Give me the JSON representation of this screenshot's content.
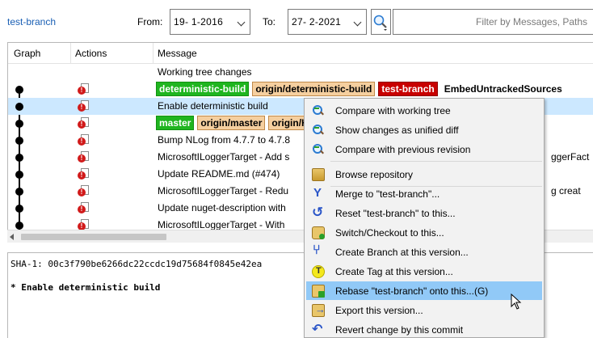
{
  "toolbar": {
    "branch": "test-branch",
    "from_label": "From:",
    "from_date": "19-  1-2016",
    "to_label": "To:",
    "to_date": "27-  2-2021",
    "filter_placeholder": "Filter by Messages, Paths"
  },
  "grid": {
    "columns": [
      "Graph",
      "Actions",
      "Message"
    ],
    "rows": [
      {
        "message": "Working tree changes"
      },
      {
        "refs": [
          {
            "label": "deterministic-build",
            "style": "green"
          },
          {
            "label": "origin/deterministic-build",
            "style": "orange"
          },
          {
            "label": "test-branch",
            "style": "red"
          },
          {
            "label": "EmbedUntrackedSources",
            "style": "plain"
          }
        ]
      },
      {
        "message": "Enable deterministic build",
        "selected": true
      },
      {
        "refs": [
          {
            "label": "master",
            "style": "green"
          },
          {
            "label": "origin/master",
            "style": "orange"
          },
          {
            "label": "origin/H",
            "style": "orange"
          }
        ]
      },
      {
        "message": "Bump NLog from 4.7.7 to 4.7.8"
      },
      {
        "message": "MicrosoftILoggerTarget - Add s",
        "tail": "ggerFact"
      },
      {
        "message": "Update README.md (#474)"
      },
      {
        "message": "MicrosoftILoggerTarget - Redu",
        "tail": "g creat"
      },
      {
        "message": "Update nuget-description with"
      },
      {
        "message": "MicrosoftILoggerTarget - With"
      }
    ]
  },
  "commit_info": {
    "sha": "SHA-1: 00c3f790be6266dc22ccdc19d75684f0845e42ea",
    "subject": "* Enable deterministic build"
  },
  "context_menu": {
    "items": [
      {
        "label": "Compare with working tree",
        "icon": "compare-icon"
      },
      {
        "label": "Show changes as unified diff",
        "icon": "diff-icon"
      },
      {
        "label": "Compare with previous revision",
        "icon": "compare-previous-icon"
      },
      {
        "label": "Browse repository",
        "icon": "repository-icon"
      },
      {
        "label": "Merge to \"test-branch\"...",
        "icon": "merge-icon"
      },
      {
        "label": "Reset \"test-branch\" to this...",
        "icon": "reset-icon"
      },
      {
        "label": "Switch/Checkout to this...",
        "icon": "switch-icon"
      },
      {
        "label": "Create Branch at this version...",
        "icon": "branch-icon"
      },
      {
        "label": "Create Tag at this version...",
        "icon": "tag-icon"
      },
      {
        "label": "Rebase \"test-branch\" onto this...(G)",
        "icon": "rebase-icon",
        "highlighted": true
      },
      {
        "label": "Export this version...",
        "icon": "export-icon"
      },
      {
        "label": "Revert change by this commit",
        "icon": "revert-icon"
      }
    ]
  },
  "colors": {
    "selection": "#cce8ff",
    "menu_highlight": "#91c9f7",
    "ref_local": "#1fb51f",
    "ref_remote": "#f5cf9f",
    "ref_current": "#c80000",
    "link": "#1a5fb4"
  }
}
